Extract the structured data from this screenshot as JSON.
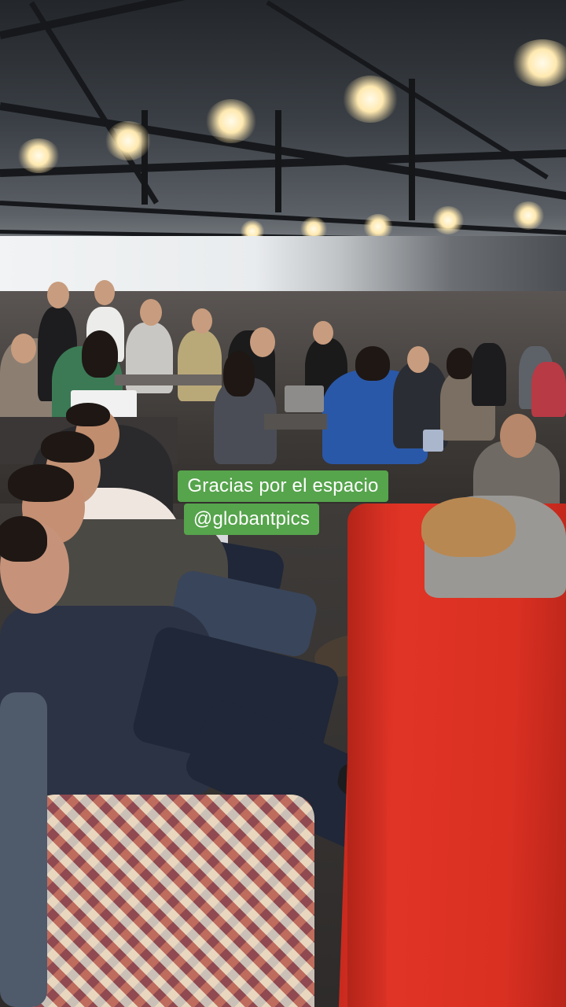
{
  "caption": {
    "line1": "Gracias por el espacio",
    "line2": "@globantpics"
  },
  "colors": {
    "caption_bg": "#56a44c",
    "caption_text": "#ffffff",
    "sofa": "#d93022"
  }
}
